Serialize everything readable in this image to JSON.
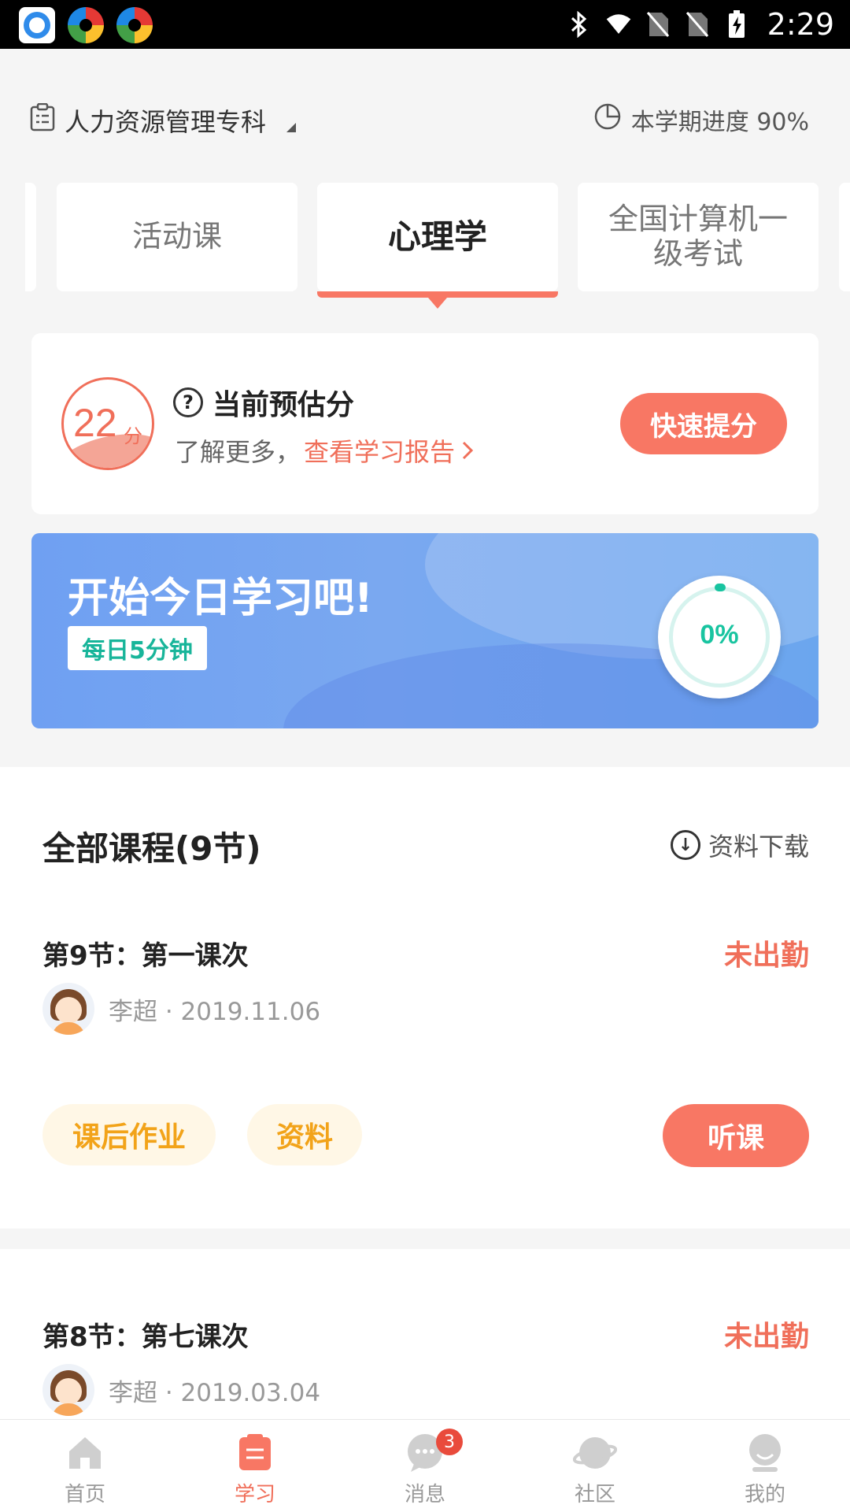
{
  "status_bar": {
    "time": "2:29"
  },
  "header": {
    "major": "人力资源管理专科",
    "semester_progress": "本学期进度 90%"
  },
  "course_tabs": [
    {
      "label": "活动课"
    },
    {
      "label": "心理学"
    },
    {
      "label": "全国计算机一级考试"
    }
  ],
  "score_card": {
    "score": "22",
    "score_unit": "分",
    "title": "当前预估分",
    "subtitle": "了解更多，",
    "report_link": "查看学习报告",
    "boost_button": "快速提分"
  },
  "daily_banner": {
    "title": "开始今日学习吧!",
    "tag": "每日5分钟",
    "progress": "0%"
  },
  "course_list": {
    "title": "全部课程(9节)",
    "download_label": "资料下载",
    "lessons": [
      {
        "title": "第9节：第一课次",
        "status": "未出勤",
        "teacher_date": "李超 · 2019.11.06",
        "homework": "课后作业",
        "materials": "资料",
        "listen": "听课"
      },
      {
        "title": "第8节：第七课次",
        "status": "未出勤",
        "teacher_date": "李超 · 2019.03.04"
      }
    ]
  },
  "bottom_nav": {
    "items": [
      {
        "label": "首页",
        "icon": "home-icon"
      },
      {
        "label": "学习",
        "icon": "study-icon"
      },
      {
        "label": "消息",
        "icon": "message-icon",
        "badge": "3"
      },
      {
        "label": "社区",
        "icon": "community-icon"
      },
      {
        "label": "我的",
        "icon": "profile-icon"
      }
    ]
  },
  "colors": {
    "accent": "#f87764",
    "teal": "#18c4a0",
    "amber": "#f2a319"
  }
}
